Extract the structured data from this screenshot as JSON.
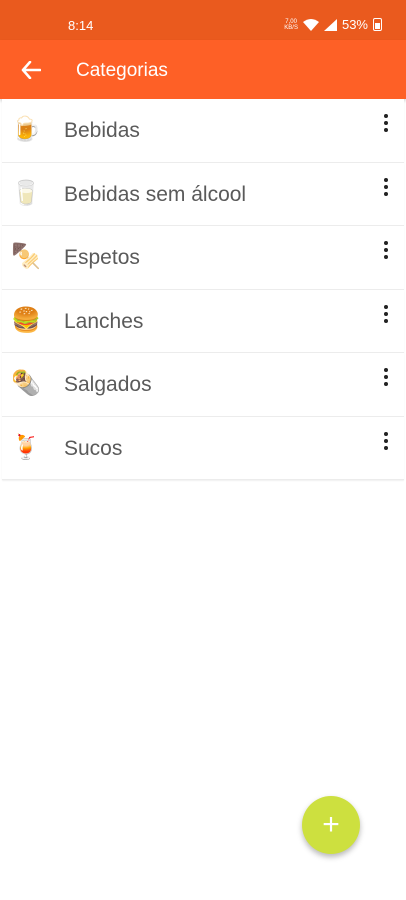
{
  "status_bar": {
    "time": "8:14",
    "net_speed_top": "7,00",
    "net_speed_bottom": "KB/S",
    "battery": "53%"
  },
  "app_bar": {
    "title": "Categorias",
    "back_icon": "arrow-left-icon"
  },
  "categories": [
    {
      "label": "Bebidas",
      "icon": "🍺",
      "icon_name": "beer-mug-icon"
    },
    {
      "label": "Bebidas sem álcool",
      "icon": "🥛",
      "icon_name": "glass-icon"
    },
    {
      "label": "Espetos",
      "icon": "🍢",
      "icon_name": "skewer-icon"
    },
    {
      "label": "Lanches",
      "icon": "🍔",
      "icon_name": "hamburger-icon"
    },
    {
      "label": "Salgados",
      "icon": "🌯",
      "icon_name": "burrito-icon"
    },
    {
      "label": "Sucos",
      "icon": "🍹",
      "icon_name": "tropical-drink-icon"
    }
  ],
  "fab": {
    "label": "+",
    "icon_name": "plus-icon"
  },
  "colors": {
    "status_bar": "#ea5a1e",
    "app_bar": "#fe6026",
    "fab": "#cde03f",
    "item_text": "#5a5a5a"
  }
}
